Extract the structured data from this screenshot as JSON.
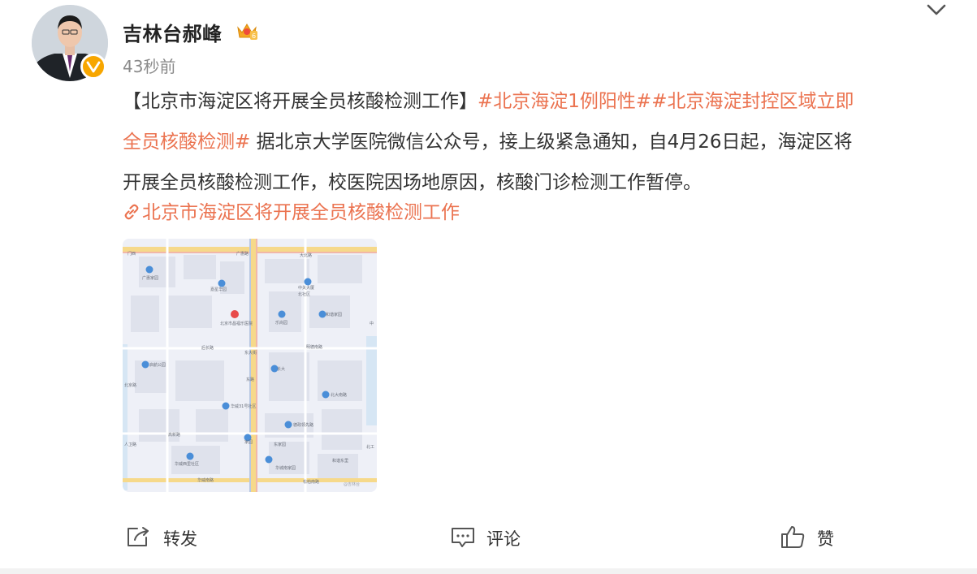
{
  "post": {
    "author": "吉林台郝峰",
    "time": "43秒前",
    "title": "【北京市海淀区将开展全员核酸检测工作】",
    "tag1": "#北京海淀1例阳性#",
    "tag2_part1": "#北京海淀封控区域立即",
    "tag2_part2": "全员核酸检测#",
    "body_line1": " 据北京大学医院微信公众号，接上级紧急通知，自4月26日起，海淀区将",
    "body_line2": "开展全员核酸检测工作，校医院因场地原因，核酸门诊检测工作暂停。",
    "link_text": "北京市海淀区将开展全员核酸检测工作",
    "icons": {
      "collapse": "chevron-down-icon",
      "verified": "verified-v-icon",
      "member": "crown-icon",
      "link": "link-icon",
      "repost": "share-icon",
      "comment": "comment-icon",
      "like": "thumbs-up-icon"
    },
    "colors": {
      "accent": "#eb7350",
      "verified": "#f7a600",
      "meta": "#8a8a8a"
    }
  },
  "map": {
    "labels": {
      "top_road": "广惠路",
      "top_left": "门西",
      "top_right": "大北路",
      "l1": "广惠家园",
      "l2": "嘉星华园",
      "l3": "北京市昌福乐医院",
      "l4": "后长路",
      "l5": "中关大厦",
      "l6": "北社区",
      "l7": "乐尚园",
      "l8": "和谐家园",
      "l9": "明德南路",
      "l10": "中",
      "l11": "启航公园",
      "l12": "长大",
      "l13": "东路",
      "l14": "北京路",
      "l15": "东大街",
      "l16": "北大南路",
      "l17": "华威31号社区",
      "l18": "德政领先路",
      "l19": "人卫路",
      "l20": "高新路",
      "l21": "家园",
      "l22": "东家园",
      "l23": "北工",
      "l24": "华威西里社区",
      "l25": "华城南家园",
      "l26": "和谐东里",
      "bottom_road1": "华威南路",
      "bottom_road2": "松柏南路",
      "watermark": "@吉林台"
    }
  },
  "actions": {
    "repost": "转发",
    "comment": "评论",
    "like": "赞"
  }
}
